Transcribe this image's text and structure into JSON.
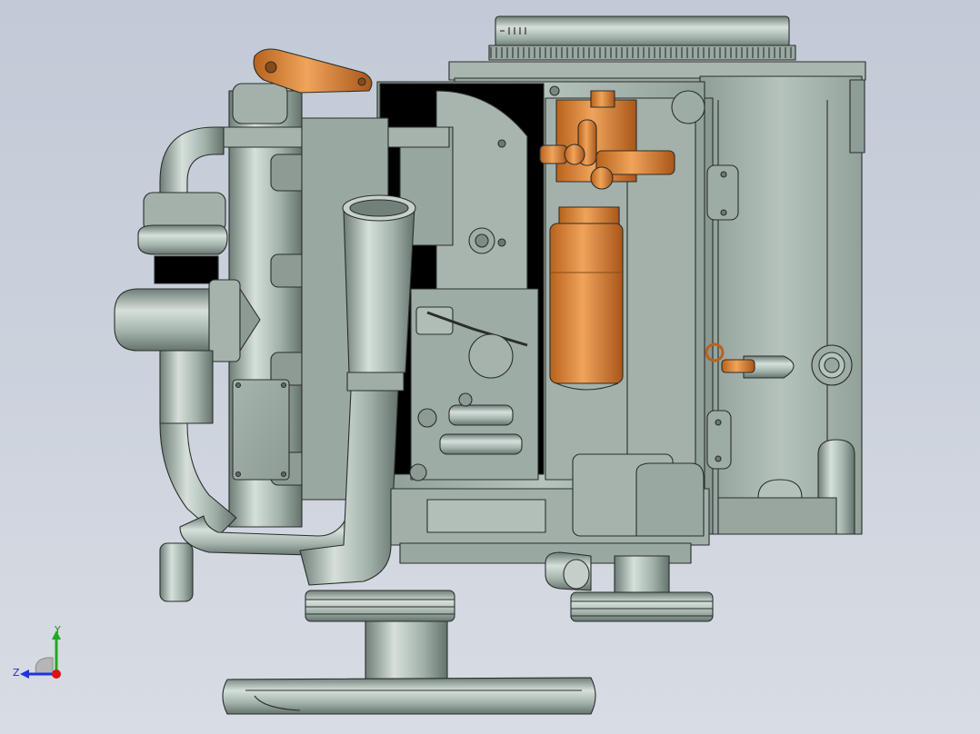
{
  "viewport": {
    "background_top": "#c2cad7",
    "background_bottom": "#d8dce4"
  },
  "model": {
    "body_color": "#aab8b1",
    "edge_color": "#2a2e2c",
    "accent_color": "#d9822b"
  },
  "triad": {
    "y_label": "Y",
    "z_label": "Z",
    "y_color": "#1faa1f",
    "z_color": "#2233dd",
    "x_color": "#dd1111"
  }
}
